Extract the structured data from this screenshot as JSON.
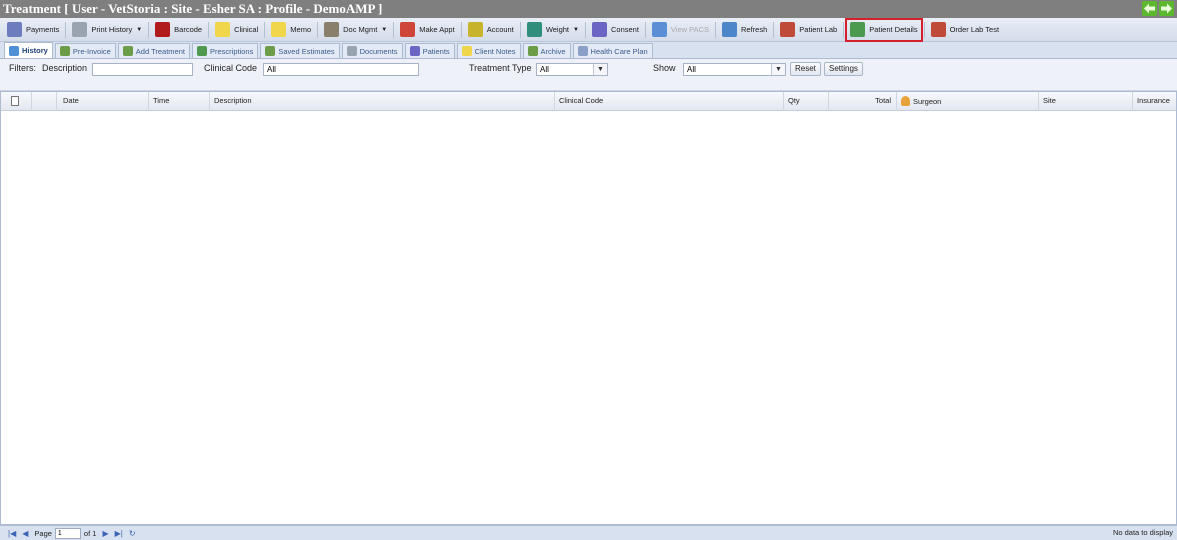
{
  "window": {
    "title": "Treatment [ User - VetStoria : Site - Esher SA : Profile - DemoAMP ]"
  },
  "toolbar": {
    "buttons": [
      {
        "label": "Payments",
        "icon": "payments-icon",
        "color": "#6d7bbf"
      },
      {
        "label": "Print History",
        "icon": "print-history-icon",
        "color": "#9aa3b0",
        "dropdown": true
      },
      {
        "label": "Barcode",
        "icon": "barcode-icon",
        "color": "#b21b1b"
      },
      {
        "label": "Clinical",
        "icon": "clinical-icon",
        "color": "#f0d64a"
      },
      {
        "label": "Memo",
        "icon": "memo-icon",
        "color": "#f0d64a"
      },
      {
        "label": "Doc Mgmt",
        "icon": "doc-mgmt-icon",
        "color": "#8a7f6b",
        "dropdown": true
      },
      {
        "label": "Make Appt",
        "icon": "calendar-icon",
        "color": "#d0453a"
      },
      {
        "label": "Account",
        "icon": "account-icon",
        "color": "#c7b32c"
      },
      {
        "label": "Weight",
        "icon": "weight-chart-icon",
        "color": "#2f8f7c",
        "dropdown": true
      },
      {
        "label": "Consent",
        "icon": "consent-icon",
        "color": "#6b66c4"
      },
      {
        "label": "View PACS",
        "icon": "pacs-icon",
        "color": "#5a8fd6",
        "disabled": true
      },
      {
        "label": "Refresh",
        "icon": "refresh-icon",
        "color": "#4d86c9"
      },
      {
        "label": "Patient Lab",
        "icon": "lab-icon",
        "color": "#c04a3a"
      },
      {
        "label": "Patient Details",
        "icon": "patient-details-icon",
        "color": "#4b9a4f",
        "highlighted": true
      },
      {
        "label": "Order Lab Test",
        "icon": "lab-order-icon",
        "color": "#c04a3a"
      }
    ]
  },
  "tabs": [
    {
      "label": "History",
      "active": true,
      "color": "#4f8fd6"
    },
    {
      "label": "Pre-Invoice",
      "color": "#6c9c48"
    },
    {
      "label": "Add Treatment",
      "color": "#6c9c48"
    },
    {
      "label": "Prescriptions",
      "color": "#4f9a4f"
    },
    {
      "label": "Saved Estimates",
      "color": "#6c9c48"
    },
    {
      "label": "Documents",
      "color": "#9aa3b0"
    },
    {
      "label": "Patients",
      "color": "#6b66c4"
    },
    {
      "label": "Client Notes",
      "color": "#f0d64a"
    },
    {
      "label": "Archive",
      "color": "#6c9c48"
    },
    {
      "label": "Health Care Plan",
      "color": "#8aa0c7"
    }
  ],
  "filters": {
    "label": "Filters:",
    "description_label": "Description",
    "description_value": "",
    "clinical_code_label": "Clinical Code",
    "clinical_code_value": "All",
    "treatment_type_label": "Treatment Type",
    "treatment_type_value": "All",
    "show_label": "Show",
    "show_value": "All",
    "reset_label": "Reset",
    "settings_label": "Settings"
  },
  "grid": {
    "columns": [
      "",
      "",
      "Date",
      "Time",
      "Description",
      "Clinical Code",
      "Qty",
      "Total",
      "Surgeon",
      "Site",
      "Insurance"
    ],
    "rows": []
  },
  "pager": {
    "page_label": "Page",
    "page_value": "1",
    "of_label": "of 1",
    "status": "No data to display"
  }
}
